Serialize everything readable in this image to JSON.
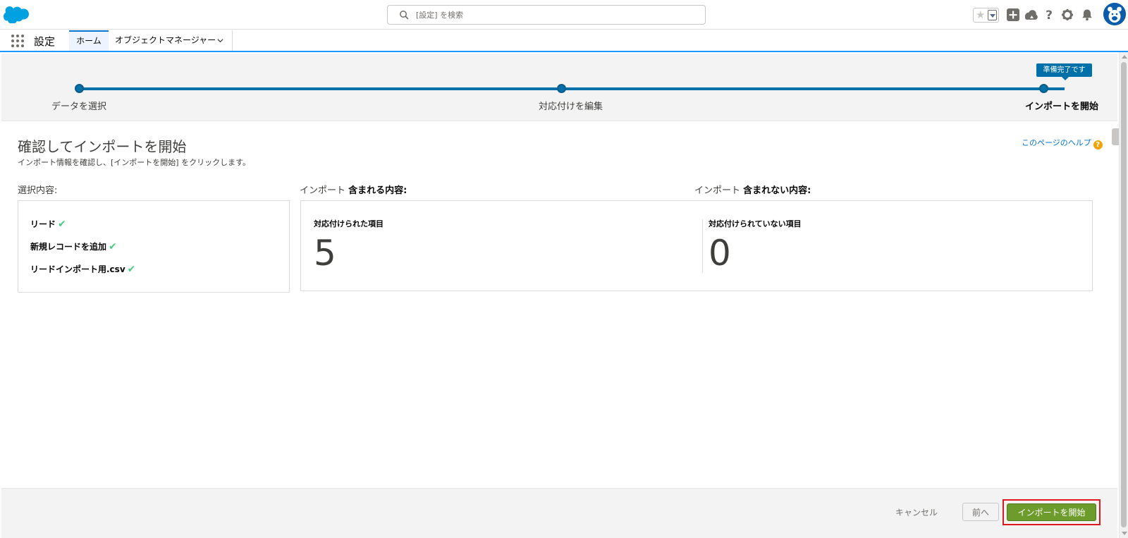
{
  "header": {
    "search_placeholder": "[設定] を検索",
    "icons": [
      "salesforce-logo",
      "search-icon",
      "star-icon",
      "add-icon",
      "trailhead-icon",
      "help-icon",
      "gear-icon",
      "bell-icon",
      "avatar"
    ]
  },
  "context_nav": {
    "app_name": "設定",
    "tabs": [
      {
        "label": "ホーム",
        "active": true
      },
      {
        "label": "オブジェクトマネージャー",
        "active": false
      }
    ]
  },
  "progress": {
    "steps": [
      {
        "label": "データを選択"
      },
      {
        "label": "対応付けを編集"
      },
      {
        "label": "インポートを開始",
        "current": true
      }
    ],
    "badge": "準備完了です"
  },
  "main": {
    "title": "確認してインポートを開始",
    "description": "インポート情報を確認し、[インポートを開始] をクリックします。",
    "help_link": "このページのヘルプ",
    "selection": {
      "label": "選択内容:",
      "items": [
        "リード",
        "新規レコードを追加",
        "リードインポート用.csv"
      ]
    },
    "included": {
      "prefix": "インポート",
      "label": "含まれる内容:",
      "stat_label": "対応付けられた項目",
      "value": "5"
    },
    "excluded": {
      "prefix": "インポート",
      "label": "含まれない内容:",
      "stat_label": "対応付けられていない項目",
      "value": "0"
    }
  },
  "footer": {
    "cancel": "キャンセル",
    "back": "前へ",
    "start": "インポートを開始"
  },
  "colors": {
    "brand": "#0070a8",
    "start_button": "#6d9c2c",
    "highlight_frame": "#e1171e",
    "check": "#4bca81"
  }
}
